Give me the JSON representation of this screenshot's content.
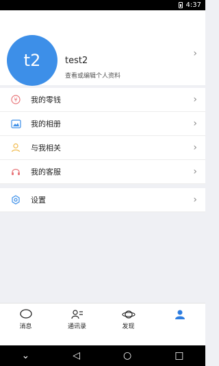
{
  "status_bar": {
    "time": "4:37"
  },
  "profile": {
    "avatar_text": "t2",
    "name": "test2",
    "subtitle": "查看或编辑个人资料"
  },
  "menu_group_1": [
    {
      "label": "我的零钱",
      "icon": "wallet-icon",
      "icon_color": "#e8767a"
    },
    {
      "label": "我的相册",
      "icon": "photo-album-icon",
      "icon_color": "#3d8fe8"
    },
    {
      "label": "与我相关",
      "icon": "person-icon",
      "icon_color": "#f0b94a"
    },
    {
      "label": "我的客服",
      "icon": "headset-icon",
      "icon_color": "#e8767a"
    }
  ],
  "menu_group_2": [
    {
      "label": "设置",
      "icon": "settings-icon",
      "icon_color": "#3d8fe8"
    }
  ],
  "bottom_nav": [
    {
      "label": "消息",
      "icon": "chat-bubble-icon"
    },
    {
      "label": "通讯录",
      "icon": "contacts-icon"
    },
    {
      "label": "发现",
      "icon": "planet-icon"
    },
    {
      "label": "",
      "icon": "person-icon",
      "active": true
    }
  ],
  "colors": {
    "accent": "#2d7de0",
    "avatar_bg": "#3d8fe8",
    "page_bg": "#eff0f4"
  }
}
